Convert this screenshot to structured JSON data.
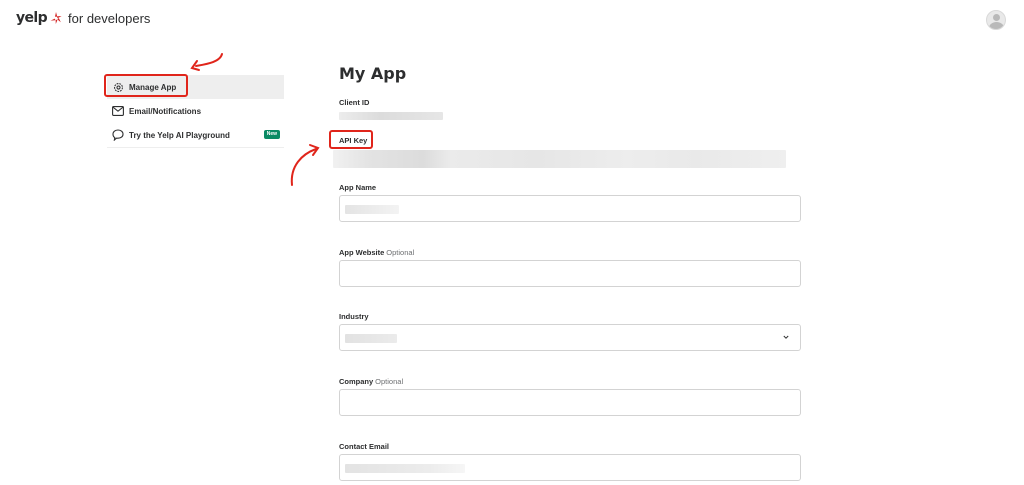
{
  "header": {
    "brand_word": "yelp",
    "brand_tag": "for developers"
  },
  "sidebar": {
    "items": [
      {
        "label": "Manage App",
        "icon": "gear-icon"
      },
      {
        "label": "Email/Notifications",
        "icon": "mail-icon"
      },
      {
        "label": "Try the Yelp AI Playground",
        "icon": "chat-bubble-icon",
        "badge": "New"
      }
    ]
  },
  "main": {
    "title": "My App",
    "client_id_label": "Client ID",
    "api_key_label": "API Key",
    "app_name_label": "App Name",
    "app_website_label": "App Website",
    "app_website_optional": "Optional",
    "industry_label": "Industry",
    "company_label": "Company",
    "company_optional": "Optional",
    "contact_email_label": "Contact Email"
  },
  "colors": {
    "brand_red": "#d32323",
    "annotation_red": "#e0251b",
    "badge_green": "#0a8a64",
    "active_bg": "#eeeeee"
  }
}
